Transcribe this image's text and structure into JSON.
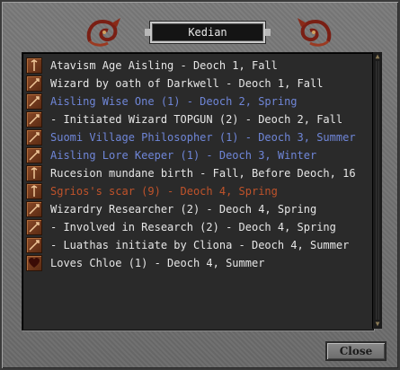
{
  "window": {
    "title": "Kedian"
  },
  "legend": {
    "items": [
      {
        "text": "Atavism Age Aisling - Deoch 1, Fall",
        "color": "#e6e6e6",
        "icon": "staff-icon"
      },
      {
        "text": "Wizard by oath of Darkwell - Deoch 1, Fall",
        "color": "#e6e6e6",
        "icon": "wand-icon"
      },
      {
        "text": "Aisling Wise One (1) - Deoch 2, Spring",
        "color": "#6f86d8",
        "icon": "wand-icon"
      },
      {
        "text": "- Initiated Wizard TOPGUN (2) - Deoch 2, Fall",
        "color": "#e6e6e6",
        "icon": "wand-icon"
      },
      {
        "text": "Suomi Village Philosopher (1) - Deoch 3, Summer",
        "color": "#6f86d8",
        "icon": "wand-icon"
      },
      {
        "text": "Aisling Lore Keeper (1) - Deoch 3, Winter",
        "color": "#6f86d8",
        "icon": "wand-icon"
      },
      {
        "text": "Rucesion mundane birth - Fall, Before Deoch, 16",
        "color": "#e6e6e6",
        "icon": "staff-icon"
      },
      {
        "text": "Sgrios's scar (9) - Deoch 4, Spring",
        "color": "#c0532a",
        "icon": "staff-icon"
      },
      {
        "text": "Wizardry Researcher (2) - Deoch 4, Spring",
        "color": "#e6e6e6",
        "icon": "wand-icon"
      },
      {
        "text": "- Involved in Research (2) - Deoch 4, Spring",
        "color": "#e6e6e6",
        "icon": "wand-icon"
      },
      {
        "text": "- Luathas initiate by Cliona - Deoch 4, Summer",
        "color": "#e6e6e6",
        "icon": "wand-icon"
      },
      {
        "text": "Loves Chloe (1) - Deoch 4, Summer",
        "color": "#e6e6e6",
        "icon": "heart-icon"
      }
    ]
  },
  "footer": {
    "close_label": "Close"
  }
}
